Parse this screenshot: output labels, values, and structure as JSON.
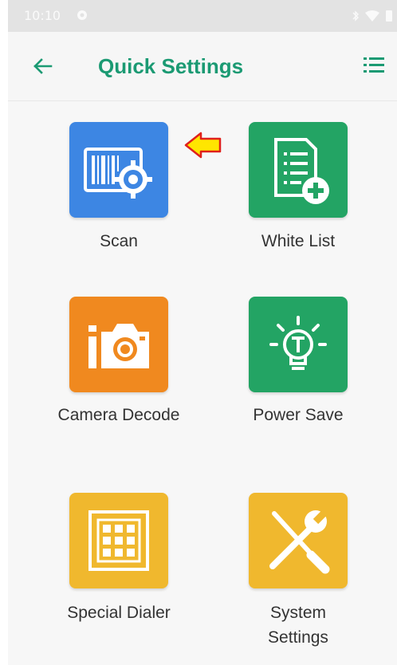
{
  "status": {
    "time": "10:10"
  },
  "appbar": {
    "title": "Quick Settings"
  },
  "items": [
    {
      "label": "Scan",
      "color": "#3d86e3"
    },
    {
      "label": "White List",
      "color": "#23a464"
    },
    {
      "label": "Camera Decode",
      "color": "#f0891f"
    },
    {
      "label": "Power Save",
      "color": "#23a464"
    },
    {
      "label": "Special Dialer",
      "color": "#f0b82e"
    },
    {
      "label": "System Settings",
      "color": "#f0b82e"
    }
  ],
  "icons": [
    "back-arrow-icon",
    "list-menu-icon",
    "barcode-gear-icon",
    "document-add-icon",
    "camera-icon",
    "lightbulb-icon",
    "keypad-icon",
    "tools-icon",
    "pointer-arrow-icon"
  ]
}
